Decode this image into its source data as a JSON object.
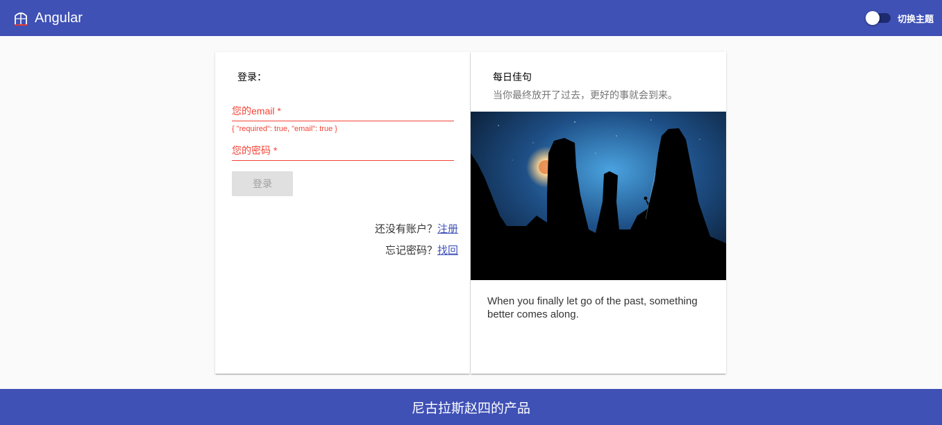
{
  "header": {
    "title": "Angular",
    "logo_icon": "angular-logo-icon",
    "theme_toggle_label": "切换主题",
    "theme_toggle_on": false,
    "background": "#3f51b5"
  },
  "login": {
    "title": "登录：",
    "email_label": "您的email *",
    "email_error": "{ \"required\": true, \"email\": true }",
    "password_label": "您的密码 *",
    "submit_label": "登录",
    "no_account_text": "还没有账户？",
    "register_link": "注册",
    "forgot_text": "忘记密码？",
    "recover_link": "找回",
    "error_color": "#f44336"
  },
  "quote": {
    "heading": "每日佳句",
    "chinese": "当你最终放开了过去，更好的事就会到来。",
    "english": "When you finally let go of the past, something better comes along.",
    "image_icon": "night-climber-image"
  },
  "footer": {
    "text": "尼古拉斯赵四的产品"
  }
}
